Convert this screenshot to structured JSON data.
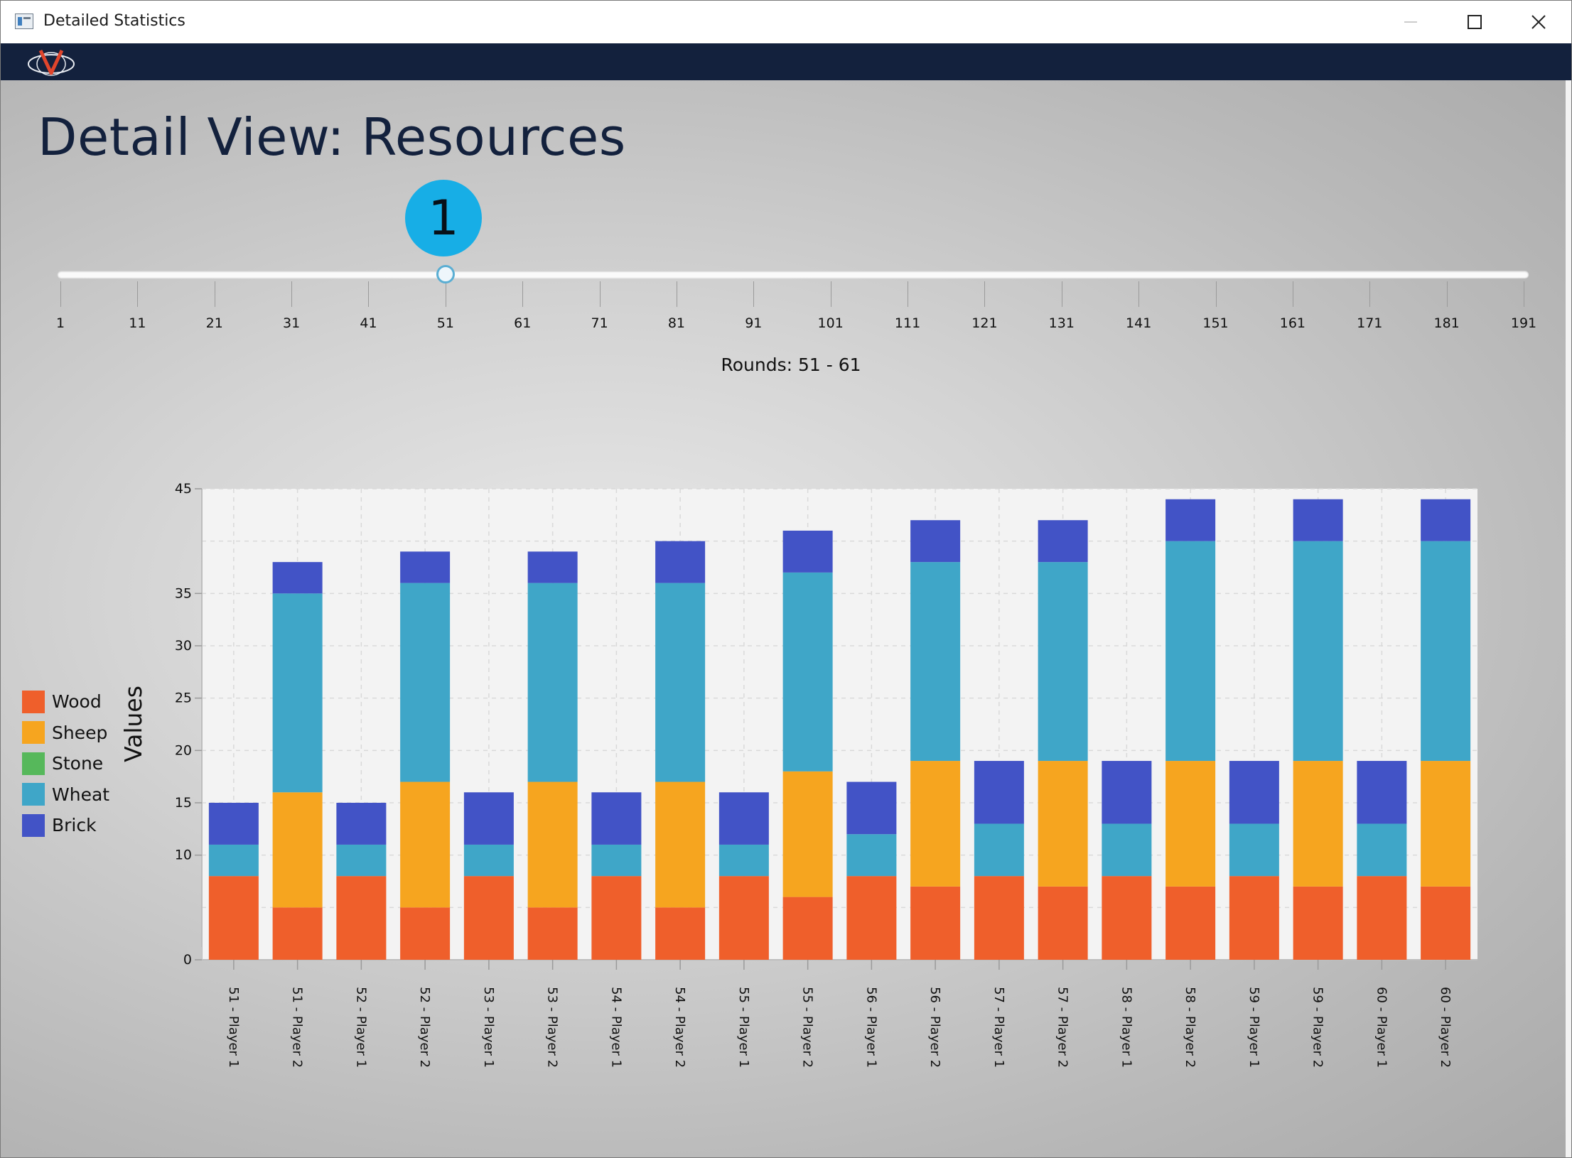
{
  "window": {
    "title": "Detailed Statistics",
    "controls": {
      "minimize": "—",
      "maximize": "☐",
      "close": "✕"
    }
  },
  "page": {
    "title": "Detail View: Resources",
    "badge": "1",
    "rounds_label": "Rounds: 51 - 61"
  },
  "slider": {
    "min": 1,
    "max": 191,
    "value": 51,
    "ticks": [
      "1",
      "11",
      "21",
      "31",
      "41",
      "51",
      "61",
      "71",
      "81",
      "91",
      "101",
      "111",
      "121",
      "131",
      "141",
      "151",
      "161",
      "171",
      "181",
      "191"
    ]
  },
  "colors": {
    "Wood": "#ef5f2b",
    "Sheep": "#f6a51f",
    "Stone": "#56b85b",
    "Wheat": "#3fa6c8",
    "Brick": "#4253c6",
    "accent": "#17aee6",
    "brand": "#13213d"
  },
  "chart_data": {
    "type": "bar",
    "stacked": true,
    "ylabel": "Values",
    "ylim": [
      0,
      45
    ],
    "yticks": [
      0,
      10,
      15,
      20,
      25,
      30,
      35,
      45
    ],
    "grid": true,
    "legend_position": "left",
    "categories": [
      "51 - Player 1",
      "51 - Player 2",
      "52 - Player 1",
      "52 - Player 2",
      "53 - Player 1",
      "53 - Player 2",
      "54 - Player 1",
      "54 - Player 2",
      "55 - Player 1",
      "55 - Player 2",
      "56 - Player 1",
      "56 - Player 2",
      "57 - Player 1",
      "57 - Player 2",
      "58 - Player 1",
      "58 - Player 2",
      "59 - Player 1",
      "59 - Player 2",
      "60 - Player 1",
      "60 - Player 2"
    ],
    "series": [
      {
        "name": "Wood",
        "values": [
          8,
          5,
          8,
          5,
          8,
          5,
          8,
          5,
          8,
          6,
          8,
          7,
          8,
          7,
          8,
          7,
          8,
          7,
          8,
          7
        ]
      },
      {
        "name": "Sheep",
        "values": [
          0,
          11,
          0,
          12,
          0,
          12,
          0,
          12,
          0,
          12,
          0,
          12,
          0,
          12,
          0,
          12,
          0,
          12,
          0,
          12
        ]
      },
      {
        "name": "Stone",
        "values": [
          0,
          0,
          0,
          0,
          0,
          0,
          0,
          0,
          0,
          0,
          0,
          0,
          0,
          0,
          0,
          0,
          0,
          0,
          0,
          0
        ]
      },
      {
        "name": "Wheat",
        "values": [
          3,
          19,
          3,
          19,
          3,
          19,
          3,
          19,
          3,
          19,
          4,
          19,
          5,
          19,
          5,
          21,
          5,
          21,
          5,
          21
        ]
      },
      {
        "name": "Brick",
        "values": [
          4,
          3,
          4,
          3,
          5,
          3,
          5,
          4,
          5,
          4,
          5,
          4,
          6,
          4,
          6,
          4,
          6,
          4,
          6,
          4
        ]
      }
    ]
  }
}
